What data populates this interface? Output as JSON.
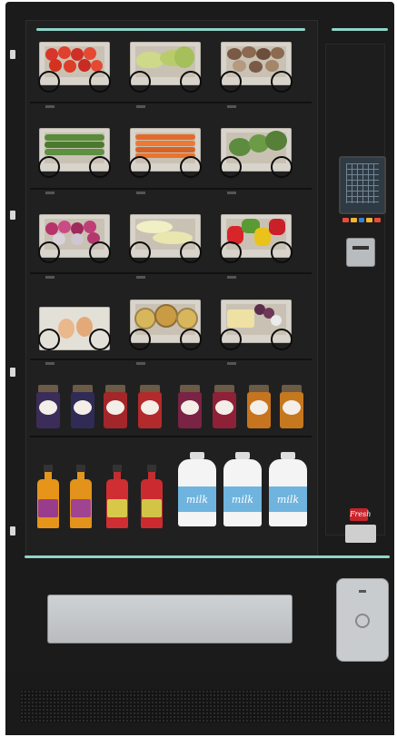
{
  "machine": {
    "accent_color": "#8fd6c8",
    "body_color": "#1b1b1c"
  },
  "products": {
    "milk_bottle_label": "milk",
    "brand_badge": "Fresh"
  },
  "icons": [
    "vending-machine",
    "keypad-screen-icon",
    "card-reader-icon",
    "coin-slot-icon",
    "pickup-tray"
  ]
}
